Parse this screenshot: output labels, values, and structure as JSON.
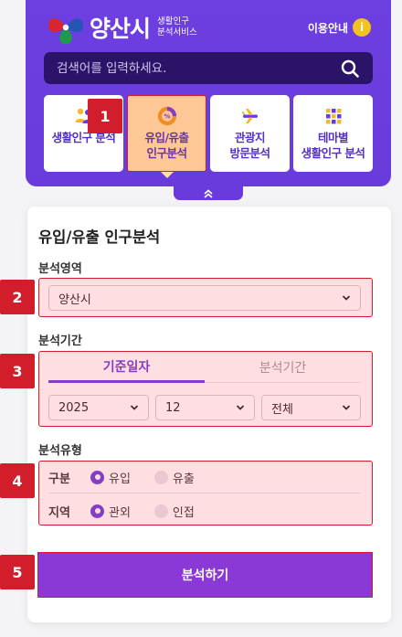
{
  "brand": {
    "name": "양산시",
    "subtitle_line1": "생활인구",
    "subtitle_line2": "분석서비스",
    "colors": {
      "red": "#d6262f",
      "green": "#1d9b4a",
      "blue": "#2655b8"
    }
  },
  "header": {
    "info_label": "이용안내",
    "info_badge": "i",
    "accent": "#6a3bdc"
  },
  "search": {
    "placeholder": "검색어를 입력하세요.",
    "icon": "search-icon"
  },
  "tiles": [
    {
      "line1": "생활인구 분석",
      "line2": "",
      "icon": "people-icon",
      "active": false
    },
    {
      "line1": "유입/유출",
      "line2": "인구분석",
      "icon": "percent-donut-icon",
      "active": true
    },
    {
      "line1": "관광지",
      "line2": "방문분석",
      "icon": "airplane-icon",
      "active": false
    },
    {
      "line1": "테마별",
      "line2": "생활인구 분석",
      "icon": "grid-icon",
      "active": false
    }
  ],
  "panel": {
    "title": "유입/유출 인구분석",
    "region": {
      "label": "분석영역",
      "value": "양산시"
    },
    "period": {
      "label": "분석기간",
      "tabs": [
        {
          "label": "기준일자",
          "active": true
        },
        {
          "label": "분석기간",
          "active": false
        }
      ],
      "year": "2025",
      "month": "12",
      "day": "전체"
    },
    "type": {
      "label": "분석유형",
      "rows": [
        {
          "label": "구분",
          "options": [
            {
              "label": "유입",
              "checked": true
            },
            {
              "label": "유출",
              "checked": false
            }
          ]
        },
        {
          "label": "지역",
          "options": [
            {
              "label": "관외",
              "checked": true
            },
            {
              "label": "인접",
              "checked": false
            }
          ]
        }
      ]
    },
    "submit_label": "분석하기"
  },
  "annotations": [
    "1",
    "2",
    "3",
    "4",
    "5"
  ]
}
